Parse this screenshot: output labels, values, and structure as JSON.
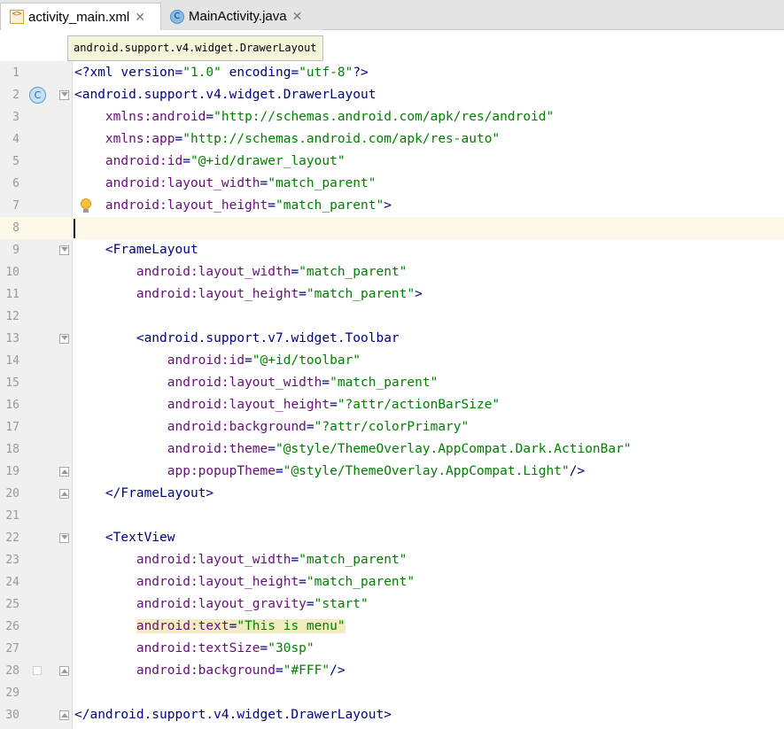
{
  "tabs": [
    {
      "label": "activity_main.xml",
      "active": true,
      "icon": "xml-file-icon"
    },
    {
      "label": "MainActivity.java",
      "active": false,
      "icon": "java-class-icon"
    }
  ],
  "tooltip": "android.support.v4.widget.DrawerLayout",
  "colors": {
    "tag": "#000080",
    "attribute": "#660e7a",
    "value": "#008000",
    "current_line": "#fcfae6"
  },
  "current_line": 8,
  "lines": [
    {
      "n": "1",
      "code": [
        {
          "t": "<?",
          "c": "tag"
        },
        {
          "t": "xml ",
          "c": "tag"
        },
        {
          "t": "version",
          "c": "tag"
        },
        {
          "t": "=",
          "c": "tag"
        },
        {
          "t": "\"1.0\"",
          "c": "val"
        },
        {
          "t": " encoding",
          "c": "tag"
        },
        {
          "t": "=",
          "c": "tag"
        },
        {
          "t": "\"utf-8\"",
          "c": "val"
        },
        {
          "t": "?>",
          "c": "tag"
        }
      ]
    },
    {
      "n": "2",
      "code": [
        {
          "t": "<android.support.v4.widget.DrawerLayout",
          "c": "tag"
        }
      ]
    },
    {
      "n": "3",
      "code": [
        {
          "t": "    ",
          "c": ""
        },
        {
          "t": "xmlns:android",
          "c": "attr"
        },
        {
          "t": "=",
          "c": "tag"
        },
        {
          "t": "\"http://schemas.android.com/apk/res/android\"",
          "c": "val"
        }
      ]
    },
    {
      "n": "4",
      "code": [
        {
          "t": "    ",
          "c": ""
        },
        {
          "t": "xmlns:app",
          "c": "attr"
        },
        {
          "t": "=",
          "c": "tag"
        },
        {
          "t": "\"http://schemas.android.com/apk/res-auto\"",
          "c": "val"
        }
      ]
    },
    {
      "n": "5",
      "code": [
        {
          "t": "    ",
          "c": ""
        },
        {
          "t": "android:id",
          "c": "attr"
        },
        {
          "t": "=",
          "c": "tag"
        },
        {
          "t": "\"@+id/drawer_layout\"",
          "c": "val"
        }
      ]
    },
    {
      "n": "6",
      "code": [
        {
          "t": "    ",
          "c": ""
        },
        {
          "t": "android:layout_width",
          "c": "attr"
        },
        {
          "t": "=",
          "c": "tag"
        },
        {
          "t": "\"match_parent\"",
          "c": "val"
        }
      ]
    },
    {
      "n": "7",
      "code": [
        {
          "t": "    ",
          "c": ""
        },
        {
          "t": "android:layout_height",
          "c": "attr"
        },
        {
          "t": "=",
          "c": "tag"
        },
        {
          "t": "\"match_parent\"",
          "c": "val"
        },
        {
          "t": ">",
          "c": "tag"
        }
      ]
    },
    {
      "n": "8",
      "code": []
    },
    {
      "n": "9",
      "code": [
        {
          "t": "    ",
          "c": ""
        },
        {
          "t": "<FrameLayout",
          "c": "tag"
        }
      ]
    },
    {
      "n": "10",
      "code": [
        {
          "t": "        ",
          "c": ""
        },
        {
          "t": "android:layout_width",
          "c": "attr"
        },
        {
          "t": "=",
          "c": "tag"
        },
        {
          "t": "\"match_parent\"",
          "c": "val"
        }
      ]
    },
    {
      "n": "11",
      "code": [
        {
          "t": "        ",
          "c": ""
        },
        {
          "t": "android:layout_height",
          "c": "attr"
        },
        {
          "t": "=",
          "c": "tag"
        },
        {
          "t": "\"match_parent\"",
          "c": "val"
        },
        {
          "t": ">",
          "c": "tag"
        }
      ]
    },
    {
      "n": "12",
      "code": []
    },
    {
      "n": "13",
      "code": [
        {
          "t": "        ",
          "c": ""
        },
        {
          "t": "<android.support.v7.widget.Toolbar",
          "c": "tag"
        }
      ]
    },
    {
      "n": "14",
      "code": [
        {
          "t": "            ",
          "c": ""
        },
        {
          "t": "android:id",
          "c": "attr"
        },
        {
          "t": "=",
          "c": "tag"
        },
        {
          "t": "\"@+id/toolbar\"",
          "c": "val"
        }
      ]
    },
    {
      "n": "15",
      "code": [
        {
          "t": "            ",
          "c": ""
        },
        {
          "t": "android:layout_width",
          "c": "attr"
        },
        {
          "t": "=",
          "c": "tag"
        },
        {
          "t": "\"match_parent\"",
          "c": "val"
        }
      ]
    },
    {
      "n": "16",
      "code": [
        {
          "t": "            ",
          "c": ""
        },
        {
          "t": "android:layout_height",
          "c": "attr"
        },
        {
          "t": "=",
          "c": "tag"
        },
        {
          "t": "\"?attr/actionBarSize\"",
          "c": "val"
        }
      ]
    },
    {
      "n": "17",
      "code": [
        {
          "t": "            ",
          "c": ""
        },
        {
          "t": "android:background",
          "c": "attr"
        },
        {
          "t": "=",
          "c": "tag"
        },
        {
          "t": "\"?attr/colorPrimary\"",
          "c": "val"
        }
      ]
    },
    {
      "n": "18",
      "code": [
        {
          "t": "            ",
          "c": ""
        },
        {
          "t": "android:theme",
          "c": "attr"
        },
        {
          "t": "=",
          "c": "tag"
        },
        {
          "t": "\"@style/ThemeOverlay.AppCompat.Dark.ActionBar\"",
          "c": "val"
        }
      ]
    },
    {
      "n": "19",
      "code": [
        {
          "t": "            ",
          "c": ""
        },
        {
          "t": "app:popupTheme",
          "c": "attr"
        },
        {
          "t": "=",
          "c": "tag"
        },
        {
          "t": "\"@style/ThemeOverlay.AppCompat.Light\"",
          "c": "val"
        },
        {
          "t": "/>",
          "c": "tag"
        }
      ]
    },
    {
      "n": "20",
      "code": [
        {
          "t": "    ",
          "c": ""
        },
        {
          "t": "</FrameLayout>",
          "c": "tag"
        }
      ]
    },
    {
      "n": "21",
      "code": []
    },
    {
      "n": "22",
      "code": [
        {
          "t": "    ",
          "c": ""
        },
        {
          "t": "<TextView",
          "c": "tag"
        }
      ]
    },
    {
      "n": "23",
      "code": [
        {
          "t": "        ",
          "c": ""
        },
        {
          "t": "android:layout_width",
          "c": "attr"
        },
        {
          "t": "=",
          "c": "tag"
        },
        {
          "t": "\"match_parent\"",
          "c": "val"
        }
      ]
    },
    {
      "n": "24",
      "code": [
        {
          "t": "        ",
          "c": ""
        },
        {
          "t": "android:layout_height",
          "c": "attr"
        },
        {
          "t": "=",
          "c": "tag"
        },
        {
          "t": "\"match_parent\"",
          "c": "val"
        }
      ]
    },
    {
      "n": "25",
      "code": [
        {
          "t": "        ",
          "c": ""
        },
        {
          "t": "android:layout_gravity",
          "c": "attr"
        },
        {
          "t": "=",
          "c": "tag"
        },
        {
          "t": "\"start\"",
          "c": "val"
        }
      ]
    },
    {
      "n": "26",
      "code": [
        {
          "t": "        ",
          "c": ""
        },
        {
          "t": "android:text",
          "c": "attr hl"
        },
        {
          "t": "=",
          "c": "tag hl"
        },
        {
          "t": "\"This is menu\"",
          "c": "val hl"
        }
      ]
    },
    {
      "n": "27",
      "code": [
        {
          "t": "        ",
          "c": ""
        },
        {
          "t": "android:textSize",
          "c": "attr"
        },
        {
          "t": "=",
          "c": "tag"
        },
        {
          "t": "\"30sp\"",
          "c": "val"
        }
      ]
    },
    {
      "n": "28",
      "code": [
        {
          "t": "        ",
          "c": ""
        },
        {
          "t": "android:background",
          "c": "attr"
        },
        {
          "t": "=",
          "c": "tag"
        },
        {
          "t": "\"#FFF\"",
          "c": "val"
        },
        {
          "t": "/>",
          "c": "tag"
        }
      ]
    },
    {
      "n": "29",
      "code": []
    },
    {
      "n": "30",
      "code": [
        {
          "t": "</android.support.v4.widget.DrawerLayout>",
          "c": "tag"
        }
      ]
    }
  ],
  "gutter_marks": {
    "fold_open": [
      2,
      9,
      13,
      22
    ],
    "fold_close": [
      19,
      20,
      28,
      30
    ],
    "class_icon_line": 2,
    "bulb_icon_line": 7,
    "bookmark_line": 28
  }
}
